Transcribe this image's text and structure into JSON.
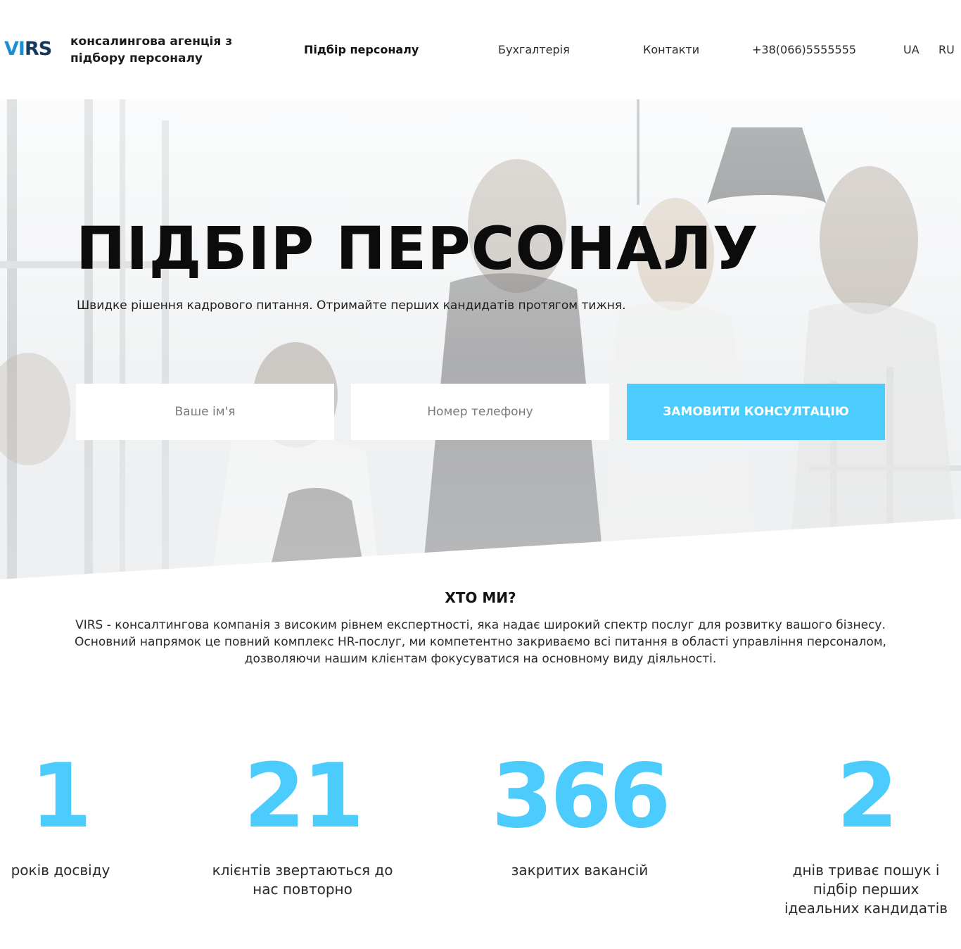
{
  "header": {
    "logo_text_a": "VI",
    "logo_text_b": "RS",
    "tagline": "консалингова агенція з підбору персоналу",
    "nav": [
      {
        "label": "Підбір персоналу",
        "active": true
      },
      {
        "label": "Бухгалтерія",
        "active": false
      },
      {
        "label": "Контакти",
        "active": false
      }
    ],
    "phone": "+38(066)5555555",
    "langs": [
      "UA",
      "RU"
    ]
  },
  "hero": {
    "title": "ПІДБІР ПЕРСОНАЛУ",
    "subtitle": "Швидке рішення кадрового питання. Отримайте перших кандидатів протягом тижня.",
    "name_placeholder": "Ваше ім'я",
    "phone_placeholder": "Номер телефону",
    "cta_label": "ЗАМОВИТИ КОНСУЛТАЦІЮ"
  },
  "about": {
    "title": "ХТО МИ?",
    "text": "VIRS - консалтингова компанія з високим рівнем експертності, яка надає широкий спектр послуг для розвитку вашого бізнесу. Основний напрямок це повний комплекс HR-послуг, ми компетентно закриваємо всі питання в області управління персоналом, дозволяючи нашим клієнтам фокусуватися на основному виду діяльності."
  },
  "stats": [
    {
      "value": "1",
      "label": "років досвіду"
    },
    {
      "value": "21",
      "label": "клієнтів звертаються до нас повторно"
    },
    {
      "value": "366",
      "label": "закритих вакансій"
    },
    {
      "value": "2",
      "label": "днів триває пошук і підбір перших ідеальних кандидатів"
    }
  ],
  "colors": {
    "accent": "#4ccbfd",
    "logo_light": "#1b8fd6",
    "logo_dark": "#143a5c"
  }
}
